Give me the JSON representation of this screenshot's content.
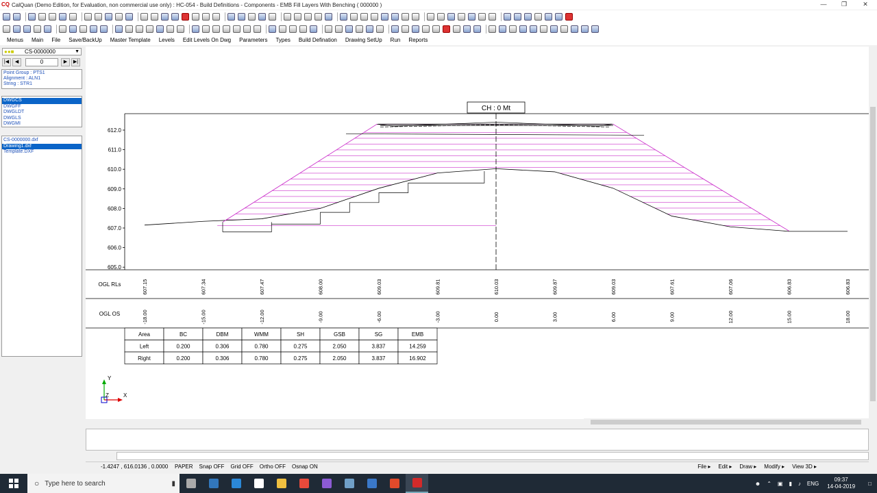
{
  "window": {
    "icon_label": "CQ",
    "title": "CalQuan (Demo Edition, for Evaluation, non commercial use only) : HC-054 - Build Definitions - Components - EMB Fill Layers With Benching ( 000000 )",
    "controls": [
      "—",
      "❐",
      "✕"
    ]
  },
  "menu": [
    "Menus",
    "Main",
    "File",
    "Save/BackUp",
    "Master Template",
    "Levels",
    "Edit Levels On Dwg",
    "Parameters",
    "Types",
    "Build Defination",
    "Drawing SetUp",
    "Run",
    "Reports"
  ],
  "left_panel": {
    "combo_value": "CS-0000000",
    "nav_value": "0",
    "nav_buttons": [
      "|◀",
      "◀",
      "▶",
      "▶|"
    ],
    "info": [
      "Point Group : PTS1",
      "Alignment : ALN1",
      "String : STR1"
    ],
    "layers": [
      "DWGCS",
      "DWGFF",
      "DWGLDT",
      "DWGLS",
      "DWGMI"
    ],
    "layers_selected": 0,
    "files": [
      "CS-0000000.dxf",
      "Drawing1.dxf",
      "Template.DXF"
    ],
    "files_selected": 1
  },
  "drawing": {
    "chainage_label": "CH : 0 Mt",
    "y_ticks": [
      "612.0",
      "611.0",
      "610.0",
      "609.0",
      "608.0",
      "607.0",
      "606.0",
      "605.0"
    ],
    "row_labels": [
      "OGL RLs",
      "OGL OS"
    ],
    "ogl_rls": [
      "607.15",
      "607.34",
      "607.47",
      "608.00",
      "609.03",
      "609.81",
      "610.03",
      "609.87",
      "609.03",
      "607.61",
      "607.06",
      "606.83",
      "606.83"
    ],
    "ogl_os": [
      "-18.00",
      "-15.00",
      "-12.00",
      "-9.00",
      "-6.00",
      "-3.00",
      "0.00",
      "3.00",
      "6.00",
      "9.00",
      "12.00",
      "15.00",
      "18.00"
    ],
    "colors": {
      "fill_hatch": "#cc33cc",
      "ground": "#000000"
    },
    "area_table": {
      "headers": [
        "Area",
        "BC",
        "DBM",
        "WMM",
        "SH",
        "GSB",
        "SG",
        "EMB"
      ],
      "rows": [
        [
          "Left",
          "0.200",
          "0.306",
          "0.780",
          "0.275",
          "2.050",
          "3.837",
          "14.259"
        ],
        [
          "Right",
          "0.200",
          "0.306",
          "0.780",
          "0.275",
          "2.050",
          "3.837",
          "16.902"
        ]
      ]
    },
    "axis_labels": {
      "y": "Y",
      "z": "Z",
      "x": "X"
    }
  },
  "status": {
    "coords": "-1.4247 , 616.0136 , 0.0000",
    "modes": [
      "PAPER",
      "Snap OFF",
      "Grid OFF",
      "Ortho OFF",
      "Osnap ON"
    ],
    "menus": [
      "File ▸",
      "Edit ▸",
      "Draw ▸",
      "Modify ▸",
      "View 3D ▸"
    ]
  },
  "taskbar": {
    "search_placeholder": "Type here to search",
    "apps": [
      "task-view",
      "edge",
      "store",
      "mail",
      "explorer",
      "chrome",
      "visual-studio",
      "app-blue",
      "app-gray",
      "app-red",
      "calquan"
    ],
    "app_colors": [
      "#aaaaaa",
      "#3277bc",
      "#2b88d8",
      "#ffffff",
      "#f0c040",
      "#e84a3b",
      "#8c5bd4",
      "#70a0c8",
      "#3a78c8",
      "#e04a2b",
      "#d22a2a"
    ],
    "tray_lang": "ENG",
    "time": "09:37",
    "date": "14-04-2019"
  }
}
